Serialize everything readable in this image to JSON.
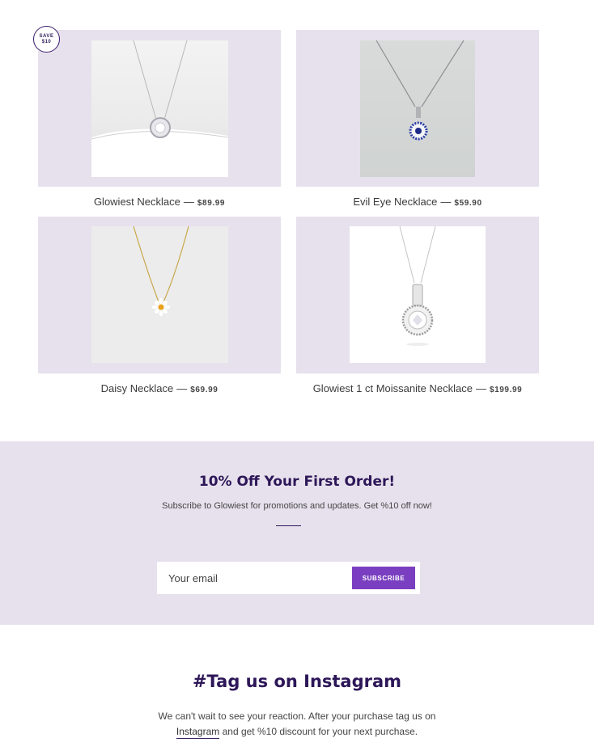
{
  "badge": {
    "line1": "SAVE",
    "line2": "$10"
  },
  "products": [
    {
      "name": "Glowiest Necklace",
      "sep": "—",
      "price": "$89.99"
    },
    {
      "name": "Evil Eye Necklace",
      "sep": "—",
      "price": "$59.90"
    },
    {
      "name": "Daisy Necklace",
      "sep": "—",
      "price": "$69.99"
    },
    {
      "name": "Glowiest 1 ct Moissanite Necklace",
      "sep": "—",
      "price": "$199.99"
    }
  ],
  "newsletter": {
    "title": "10% Off Your First Order!",
    "subtitle": "Subscribe to Glowiest for promotions and updates. Get %10 off now!",
    "email_placeholder": "Your email",
    "email_value": "",
    "subscribe_label": "SUBSCRIBE"
  },
  "instagram": {
    "title": "#Tag us on Instagram",
    "line1": "We can't wait to see your reaction. After your purchase tag us on",
    "link": "Instagram",
    "line2_rest": " and get %10 discount for your next purchase."
  },
  "colors": {
    "card_bg": "#e7e1ed",
    "accent": "#7a3fc0",
    "heading": "#2d1758"
  }
}
